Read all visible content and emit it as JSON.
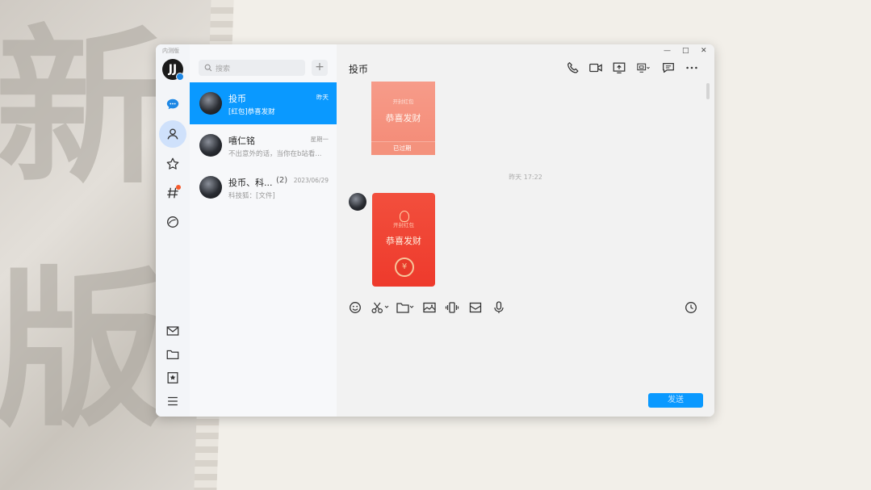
{
  "background": {
    "glyph_top": "新",
    "glyph_bottom": "版"
  },
  "window": {
    "app_badge": "内测版",
    "controls": {
      "minimize": "—",
      "maximize": "□",
      "close": "✕"
    }
  },
  "rail": {
    "avatar_text": "JJ",
    "items": [
      {
        "name": "messages",
        "icon": "chat-bubble-icon",
        "active": false
      },
      {
        "name": "contacts",
        "icon": "person-icon",
        "active": true
      },
      {
        "name": "favorites",
        "icon": "star-icon",
        "active": false
      },
      {
        "name": "channels",
        "icon": "hashtag-icon",
        "active": false,
        "badge": true
      },
      {
        "name": "guild",
        "icon": "planet-icon",
        "active": false
      }
    ],
    "bottom_items": [
      {
        "name": "mail",
        "icon": "mail-icon"
      },
      {
        "name": "files",
        "icon": "folder-icon"
      },
      {
        "name": "bookmarks",
        "icon": "bookmark-icon"
      },
      {
        "name": "menu",
        "icon": "menu-icon"
      }
    ]
  },
  "list": {
    "search_placeholder": "搜索",
    "plus_label": "+",
    "conversations": [
      {
        "name": "投币",
        "count": "",
        "time": "昨天",
        "preview": "[红包]恭喜发财",
        "active": true
      },
      {
        "name": "嘻仁铭",
        "count": "",
        "time": "星期一",
        "preview": "不出意外的话，当你在b站看...",
        "active": false
      },
      {
        "name": "投币、科...",
        "count": "(2)",
        "time": "2023/06/29",
        "preview": "科技狐：[文件]",
        "active": false
      }
    ]
  },
  "chat": {
    "title": "投币",
    "header_icons": [
      "phone-icon",
      "video-icon",
      "screen-share-icon",
      "remote-desktop-icon",
      "message-icon",
      "more-icon"
    ],
    "old_envelope": {
      "brand": "开封红包",
      "greeting": "恭喜发财",
      "status": "已过期"
    },
    "timestamp": "昨天 17:22",
    "new_envelope": {
      "brand": "开封红包",
      "greeting": "恭喜发财",
      "seal": "¥"
    },
    "toolbar_icons": [
      "emoji-icon",
      "scissors-icon",
      "folder-icon",
      "image-icon",
      "shake-icon",
      "gift-icon",
      "microphone-icon",
      "clock-icon"
    ],
    "send_label": "发送"
  }
}
